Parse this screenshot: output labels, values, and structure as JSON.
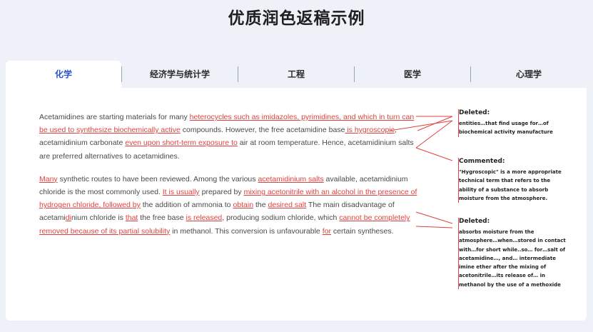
{
  "page_title": "优质润色返稿示例",
  "tabs": [
    {
      "label": "化学",
      "active": true
    },
    {
      "label": "经济学与统计学",
      "active": false
    },
    {
      "label": "工程",
      "active": false
    },
    {
      "label": "医学",
      "active": false
    },
    {
      "label": "心理学",
      "active": false
    }
  ],
  "paragraph1": {
    "segments": [
      {
        "text": "Acetamidines are starting materials for many ",
        "edited": false
      },
      {
        "text": "heterocycles such as imidazoles, pyrimidines, and which in turn can be used to synthesize biochemically active",
        "edited": true
      },
      {
        "text": " compounds. However, the free acetamidine base",
        "edited": false
      },
      {
        "text": " is hygroscopic",
        "edited": true
      },
      {
        "text": ", acetamidinium carbonate ",
        "edited": false
      },
      {
        "text": "even upon short-term exposure to",
        "edited": true
      },
      {
        "text": " air at room temperature. Hence, acetamidinium salts are preferred alternatives to acetamidines.",
        "edited": false
      }
    ]
  },
  "paragraph2": {
    "segments": [
      {
        "text": "Many",
        "edited": true
      },
      {
        "text": " synthetic routes to have been reviewed. Among the various ",
        "edited": false
      },
      {
        "text": "acetamidinium salts",
        "edited": true
      },
      {
        "text": " available, acetamidinium chloride is the most commonly used. ",
        "edited": false
      },
      {
        "text": "It is usually",
        "edited": true
      },
      {
        "text": " prepared by ",
        "edited": false
      },
      {
        "text": "mixing acetonitrile with an alcohol in the presence of hydrogen chloride, followed by",
        "edited": true
      },
      {
        "text": " the addition of ammonia to ",
        "edited": false
      },
      {
        "text": "obtain",
        "edited": true
      },
      {
        "text": " the ",
        "edited": false
      },
      {
        "text": "desired salt",
        "edited": true
      },
      {
        "text": " The main disadvantage of acetami",
        "edited": false
      },
      {
        "text": "di",
        "edited": true
      },
      {
        "text": "nium chloride is ",
        "edited": false
      },
      {
        "text": "that",
        "edited": true
      },
      {
        "text": " the free base ",
        "edited": false
      },
      {
        "text": "is released",
        "edited": true
      },
      {
        "text": ", producing sodium chloride, which ",
        "edited": false
      },
      {
        "text": "cannot be completely removed because of its partial solubility",
        "edited": true
      },
      {
        "text": " in methanol. This conversion is unfavourable ",
        "edited": false
      },
      {
        "text": "for",
        "edited": true
      },
      {
        "text": " certain syntheses.",
        "edited": false
      }
    ]
  },
  "notes": [
    {
      "heading": "Deleted:",
      "body": "entities…that find usage for…of biochemical activity manufacture"
    },
    {
      "heading": "Commented:",
      "body": "\"Hygroscopic\" is a more appropriate technical term that refers to the ability of a substance to absorb moisture from the atmosphere."
    },
    {
      "heading": "Deleted:",
      "body": "absorbs moisture from the atmosphere…when…stored in contact with…for short while..so… for…salt of acetamidine…, and… intermediate imine ether after the mixing of acetonitrile…its release of… in methanol by the use of a methoxide"
    }
  ],
  "colors": {
    "accent": "#e0433f",
    "tab_active_text": "#2b55c9",
    "background": "#eef1f7"
  }
}
